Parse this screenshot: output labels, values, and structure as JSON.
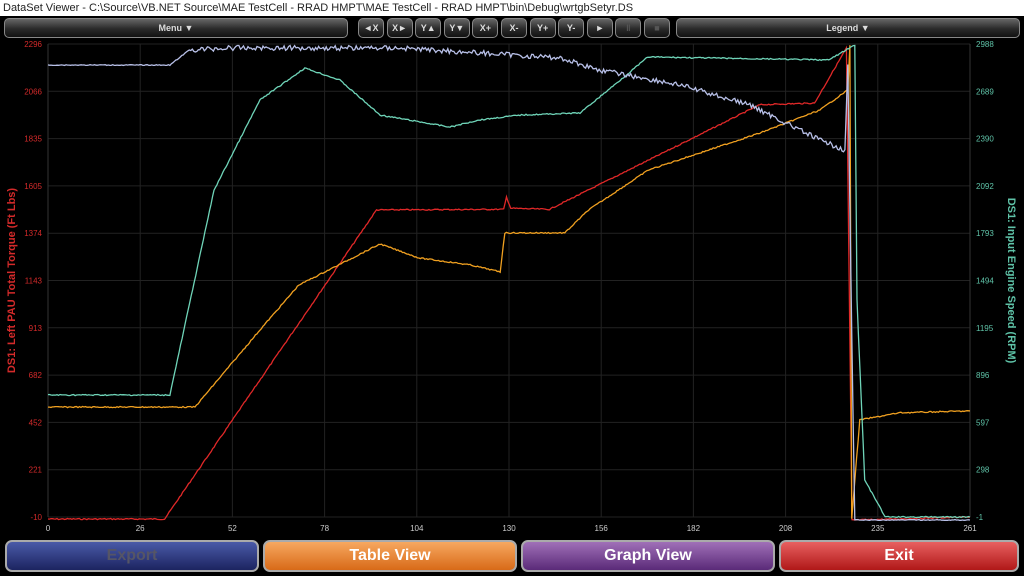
{
  "window": {
    "title": "DataSet Viewer - C:\\Source\\VB.NET Source\\MAE TestCell - RRAD HMPT\\MAE TestCell - RRAD HMPT\\bin\\Debug\\wrtgbSetyr.DS"
  },
  "toolbar": {
    "menu": "Menu ▼",
    "legend": "Legend ▼",
    "buttons": [
      "◄X",
      "X►",
      "Y▲",
      "Y▼",
      "X+",
      "X-",
      "Y+",
      "Y-",
      "►",
      "‖",
      "■"
    ]
  },
  "footer": {
    "export": "Export",
    "table_view": "Table View",
    "graph_view": "Graph View",
    "exit": "Exit"
  },
  "chart_data": {
    "type": "line",
    "grid": true,
    "xlim": [
      0,
      261
    ],
    "x_ticks": [
      "0",
      "26",
      "52",
      "78",
      "104",
      "130",
      "156",
      "182",
      "208",
      "235",
      "261"
    ],
    "y_left": {
      "label": "DS1: Left PAU Total Torque (Ft Lbs)",
      "range": [
        -10,
        2296
      ],
      "ticks": [
        "2296",
        "2066",
        "1835",
        "1605",
        "1374",
        "1143",
        "913",
        "682",
        "452",
        "221",
        "-10"
      ],
      "color": "#d42a2a"
    },
    "y_right": {
      "label": "DS1: Input Engine Speed (RPM)",
      "range": [
        -1,
        2988
      ],
      "ticks": [
        "2988",
        "2689",
        "2390",
        "2092",
        "1793",
        "1494",
        "1195",
        "896",
        "597",
        "298",
        "-1"
      ],
      "color": "#5fc3a8"
    },
    "series": [
      {
        "axis": "left",
        "color": "#e02828",
        "points": [
          [
            0,
            -20
          ],
          [
            33,
            -20
          ],
          [
            93,
            1487
          ],
          [
            129,
            1490
          ],
          [
            129.8,
            1550
          ],
          [
            131,
            1495
          ],
          [
            142,
            1490
          ],
          [
            201.5,
            2000
          ],
          [
            217,
            2008
          ],
          [
            226,
            2276
          ],
          [
            227.6,
            -25
          ],
          [
            261,
            -10
          ]
        ]
      },
      {
        "axis": "left",
        "color": "#f0a020",
        "points": [
          [
            0,
            526
          ],
          [
            41.6,
            526
          ],
          [
            60,
            902
          ],
          [
            71,
            1121
          ],
          [
            94,
            1321
          ],
          [
            105,
            1253
          ],
          [
            119.5,
            1219
          ],
          [
            128,
            1185
          ],
          [
            129.3,
            1375
          ],
          [
            146.3,
            1375
          ],
          [
            153,
            1487
          ],
          [
            170,
            1682
          ],
          [
            201.5,
            1862
          ],
          [
            218.5,
            1974
          ],
          [
            226.4,
            2072
          ],
          [
            227,
            2291
          ],
          [
            227.5,
            -20
          ],
          [
            229.8,
            463
          ],
          [
            241,
            498
          ],
          [
            261,
            507
          ]
        ]
      },
      {
        "axis": "right",
        "color": "#6fd4b8",
        "points": [
          [
            0,
            770
          ],
          [
            34.5,
            770
          ],
          [
            47,
            2065
          ],
          [
            60,
            2634
          ],
          [
            72.7,
            2836
          ],
          [
            82.6,
            2760
          ],
          [
            94,
            2539
          ],
          [
            113.8,
            2463
          ],
          [
            122,
            2508
          ],
          [
            133.6,
            2539
          ],
          [
            150.6,
            2552
          ],
          [
            162,
            2760
          ],
          [
            169.8,
            2906
          ],
          [
            221,
            2887
          ],
          [
            228.4,
            2982
          ],
          [
            229,
            1370
          ],
          [
            231.2,
            233
          ],
          [
            237,
            -1
          ],
          [
            261,
            -1
          ]
        ]
      },
      {
        "axis": "right",
        "color": "#b8c0e8",
        "points": [
          [
            0,
            2855
          ],
          [
            34.5,
            2855
          ],
          [
            40,
            2950
          ],
          [
            51.5,
            2963
          ],
          [
            99.6,
            2963
          ],
          [
            145,
            2900
          ],
          [
            156,
            2824
          ],
          [
            179,
            2729
          ],
          [
            198.7,
            2603
          ],
          [
            210,
            2476
          ],
          [
            218.5,
            2381
          ],
          [
            225.6,
            2318
          ],
          [
            226.4,
            2850
          ],
          [
            227.5,
            1180
          ],
          [
            228.4,
            -20
          ],
          [
            261,
            -20
          ]
        ]
      }
    ]
  }
}
